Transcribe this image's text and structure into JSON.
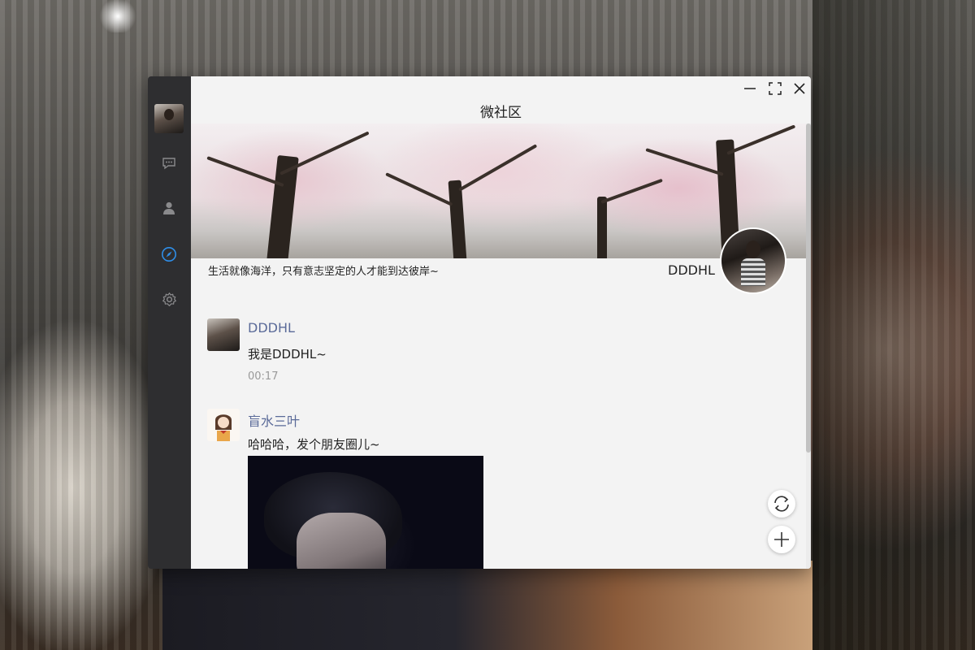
{
  "window": {
    "title": "微社区",
    "controls": {
      "minimize_icon": "minimize-icon",
      "maximize_icon": "maximize-icon",
      "close_icon": "close-icon"
    }
  },
  "sidebar": {
    "items": [
      {
        "name": "avatar",
        "icon": "user-avatar"
      },
      {
        "name": "chat",
        "icon": "chat-bubble-icon",
        "active": false
      },
      {
        "name": "contacts",
        "icon": "person-icon",
        "active": false
      },
      {
        "name": "moments",
        "icon": "compass-icon",
        "active": true
      },
      {
        "name": "settings",
        "icon": "gear-icon",
        "active": false
      }
    ],
    "active_color": "#2e8ee8"
  },
  "profile": {
    "motto": "生活就像海洋，只有意志坚定的人才能到达彼岸~",
    "username": "DDDHL"
  },
  "posts": [
    {
      "author": "DDDHL",
      "text": "我是DDDHL~",
      "time": "00:17"
    },
    {
      "author": "盲水三叶",
      "text": "哈哈哈，发个朋友圈儿~"
    }
  ],
  "actions": {
    "refresh_icon": "refresh-icon",
    "add_icon": "plus-icon"
  },
  "colors": {
    "name_color": "#5b6b99",
    "sidebar_bg": "#2e2e30",
    "content_bg": "#f3f3f3"
  }
}
